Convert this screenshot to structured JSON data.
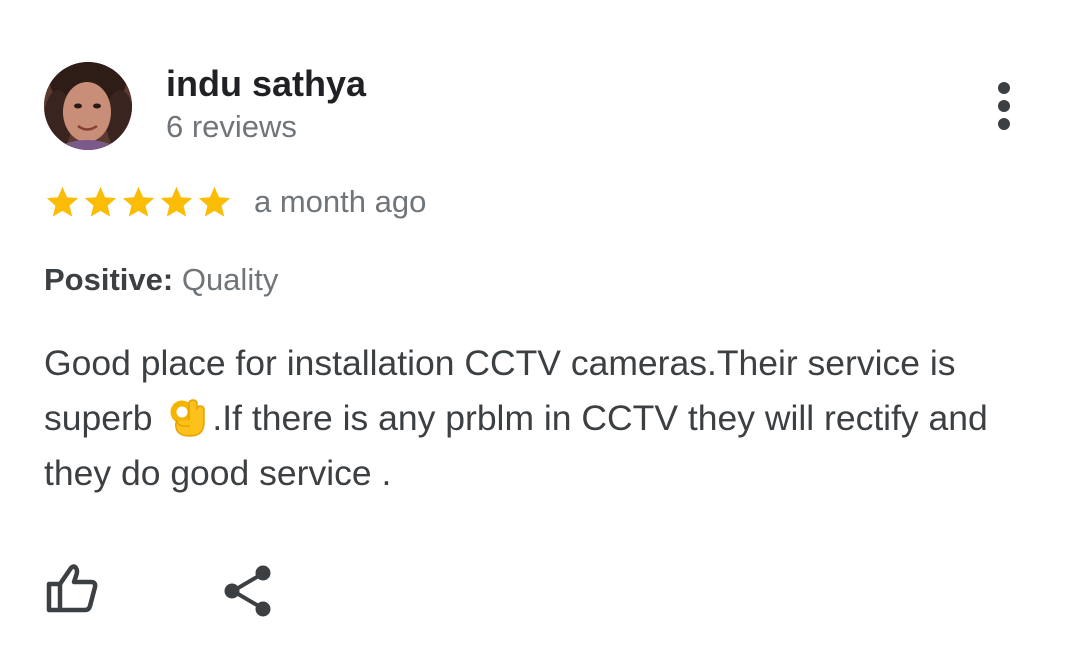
{
  "reviewer": {
    "name": "indu sathya",
    "review_count": "6 reviews",
    "avatar_icon": "profile-photo"
  },
  "rating": {
    "stars": 5,
    "max_stars": 5,
    "star_color": "#fbbc04",
    "date": "a month ago"
  },
  "attribute": {
    "label": "Positive:",
    "value": " Quality"
  },
  "review": {
    "text_before_emoji": "Good place for installation CCTV cameras.Their service is superb ",
    "emoji": "ok-hand-emoji",
    "text_after_emoji": ".If there is any prblm in CCTV they will rectify and they do good service ."
  },
  "actions": {
    "like_icon": "thumb-up-icon",
    "share_icon": "share-icon",
    "more_icon": "more-vert-icon"
  },
  "colors": {
    "text_primary": "#202124",
    "text_body": "#3c4043",
    "text_secondary": "#70757a",
    "icon": "#3c4043"
  }
}
